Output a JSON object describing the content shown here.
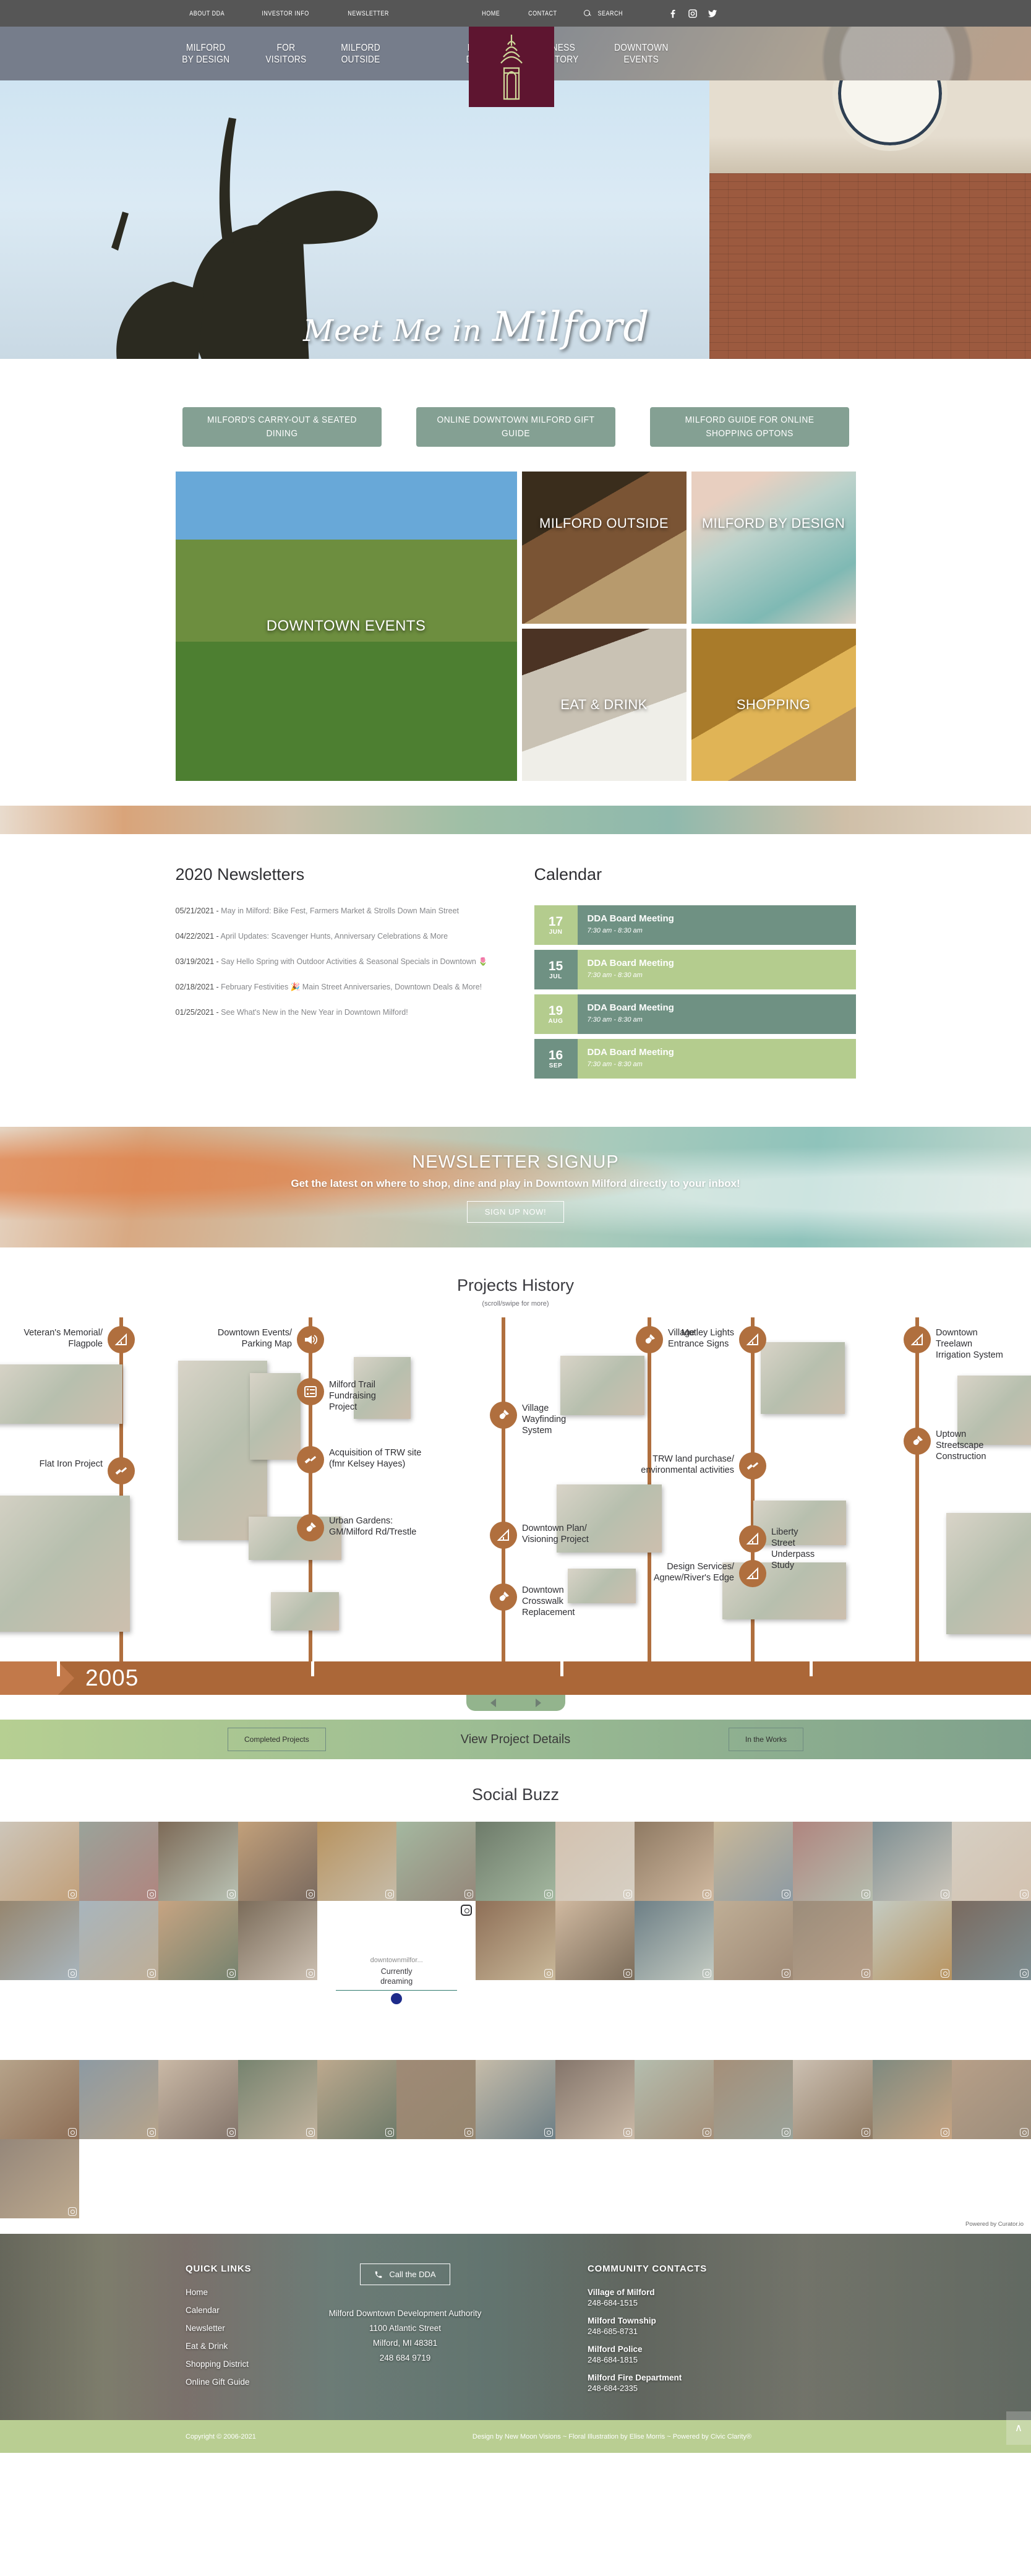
{
  "utility_nav": {
    "left": [
      {
        "label": "ABOUT DDA",
        "name": "utility-link-about-dda"
      },
      {
        "label": "INVESTOR INFO",
        "name": "utility-link-investor-info"
      },
      {
        "label": "NEWSLETTER",
        "name": "utility-link-newsletter"
      }
    ],
    "right": [
      {
        "label": "HOME",
        "name": "utility-link-home"
      },
      {
        "label": "CONTACT",
        "name": "utility-link-contact"
      }
    ],
    "search_label": "SEARCH",
    "socials": [
      "facebook-icon",
      "instagram-icon",
      "twitter-icon"
    ]
  },
  "main_nav": {
    "left": [
      {
        "line1": "MILFORD",
        "line2": "BY DESIGN"
      },
      {
        "line1": "FOR",
        "line2": "VISITORS"
      },
      {
        "line1": "MILFORD",
        "line2": "OUTSIDE"
      }
    ],
    "right": [
      {
        "line1": "EAT &",
        "line2": "DRINK"
      },
      {
        "line1": "BUSINESS",
        "line2": "DIRECTORY"
      },
      {
        "line1": "DOWNTOWN",
        "line2": "EVENTS"
      }
    ],
    "logo_color": "#5e1530"
  },
  "hero": {
    "script_small": "Meet Me in",
    "script_big": "Milford"
  },
  "cta_buttons": [
    {
      "label": "MILFORD'S CARRY-OUT & SEATED DINING",
      "name": "cta-carry-out-dining"
    },
    {
      "label": "ONLINE DOWNTOWN MILFORD GIFT GUIDE",
      "name": "cta-gift-guide"
    },
    {
      "label": "MILFORD GUIDE FOR ONLINE SHOPPING OPTONS",
      "name": "cta-online-shopping"
    }
  ],
  "tiles": {
    "big": {
      "label": "DOWNTOWN EVENTS",
      "name": "tile-downtown-events"
    },
    "small": [
      {
        "label": "MILFORD OUTSIDE",
        "name": "tile-milford-outside"
      },
      {
        "label": "MILFORD BY DESIGN",
        "name": "tile-milford-by-design"
      },
      {
        "label": "EAT & DRINK",
        "name": "tile-eat-drink"
      },
      {
        "label": "SHOPPING",
        "name": "tile-shopping"
      }
    ]
  },
  "newsletters": {
    "heading": "2020 Newsletters",
    "items": [
      {
        "date": "05/21/2021",
        "sep": " - ",
        "title": "May in Milford: Bike Fest, Farmers Market & Strolls Down Main Street"
      },
      {
        "date": "04/22/2021",
        "sep": " - ",
        "title": "April Updates: Scavenger Hunts, Anniversary Celebrations & More"
      },
      {
        "date": "03/19/2021",
        "sep": " - ",
        "title": "Say Hello Spring with Outdoor Activities & Seasonal Specials in Downtown 🌷"
      },
      {
        "date": "02/18/2021",
        "sep": " - ",
        "title": "February Festivities 🎉 Main Street Anniversaries, Downtown Deals & More!"
      },
      {
        "date": "01/25/2021",
        "sep": " - ",
        "title": "See What's New in the New Year in Downtown Milford!"
      }
    ]
  },
  "calendar": {
    "heading": "Calendar",
    "events": [
      {
        "day": "17",
        "month": "JUN",
        "title": "DDA Board Meeting",
        "time": "7:30 am - 8:30 am",
        "scheme": "sc-a"
      },
      {
        "day": "15",
        "month": "JUL",
        "title": "DDA Board Meeting",
        "time": "7:30 am - 8:30 am",
        "scheme": "sc-b"
      },
      {
        "day": "19",
        "month": "AUG",
        "title": "DDA Board Meeting",
        "time": "7:30 am - 8:30 am",
        "scheme": "sc-a"
      },
      {
        "day": "16",
        "month": "SEP",
        "title": "DDA Board Meeting",
        "time": "7:30 am - 8:30 am",
        "scheme": "sc-b"
      }
    ]
  },
  "signup": {
    "heading": "NEWSLETTER SIGNUP",
    "subheading": "Get the latest on where to shop, dine and play in Downtown Milford directly to your inbox!",
    "button": "SIGN UP NOW!"
  },
  "projects": {
    "heading": "Projects History",
    "subheading": "(scroll/swipe for more)",
    "year": "2005",
    "nodes": [
      {
        "label": "Veteran's Memorial/\nFlagpole",
        "icon": "ruler-icon"
      },
      {
        "label": "Flat Iron Project",
        "icon": "gavel-icon"
      },
      {
        "label": "Downtown Events/\nParking Map",
        "icon": "megaphone-icon"
      },
      {
        "label": "Milford Trail\nFundraising\nProject",
        "icon": "form-icon"
      },
      {
        "label": "Acquisition of TRW site\n(fmr Kelsey Hayes)",
        "icon": "gavel-icon"
      },
      {
        "label": "Urban Gardens:\nGM/Milford Rd/Trestle",
        "icon": "shovel-icon"
      },
      {
        "label": "Village\nWayfinding\nSystem",
        "icon": "shovel-icon"
      },
      {
        "label": "Village\nEntrance Signs",
        "icon": "shovel-icon"
      },
      {
        "label": "Downtown Plan/\nVisioning Project",
        "icon": "ruler-icon"
      },
      {
        "label": "Downtown\nCrosswalk\nReplacement",
        "icon": "shovel-icon"
      },
      {
        "label": "Motley Lights",
        "icon": "ruler-icon"
      },
      {
        "label": "TRW land purchase/\nenvironmental activities",
        "icon": "gavel-icon"
      },
      {
        "label": "Design Services/\nAgnew/River's Edge",
        "icon": "ruler-icon"
      },
      {
        "label": "Liberty\nStreet\nUnderpass\nStudy",
        "icon": "ruler-icon"
      },
      {
        "label": "Downtown\nTreelawn\nIrrigation System",
        "icon": "ruler-icon"
      },
      {
        "label": "Uptown\nStreetscape\nConstruction",
        "icon": "shovel-icon"
      }
    ],
    "actions": {
      "left_button": "Completed Projects",
      "center_label": "View Project Details",
      "right_button": "In the Works"
    }
  },
  "social": {
    "heading": "Social Buzz",
    "card": {
      "handle": "downtownmilfor...",
      "caption_line1": "Currently",
      "caption_line2": "dreaming"
    },
    "attribution": "Powered by Curator.io"
  },
  "footer": {
    "quick_links_head": "QUICK LINKS",
    "quick_links": [
      "Home",
      "Calendar",
      "Newsletter",
      "Eat & Drink",
      "Shopping District",
      "Online Gift Guide"
    ],
    "call_button": "Call the DDA",
    "address_lines": [
      "Milford Downtown Development Authority",
      "1100 Atlantic Street",
      "Milford, MI 48381",
      "248 684 9719"
    ],
    "contacts_head": "COMMUNITY CONTACTS",
    "contacts": [
      {
        "name": "Village of Milford",
        "phone": "248-684-1515"
      },
      {
        "name": "Milford Township",
        "phone": "248-685-8731"
      },
      {
        "name": "Milford Police",
        "phone": "248-684-1815"
      },
      {
        "name": "Milford Fire Department",
        "phone": "248-684-2335"
      }
    ]
  },
  "copyright": {
    "left": "Copyright © 2006-2021",
    "right": "Design by New Moon Visions ~ Floral Illustration by Elise Morris ~ Powered by Civic Clarity®",
    "to_top": "∧"
  }
}
